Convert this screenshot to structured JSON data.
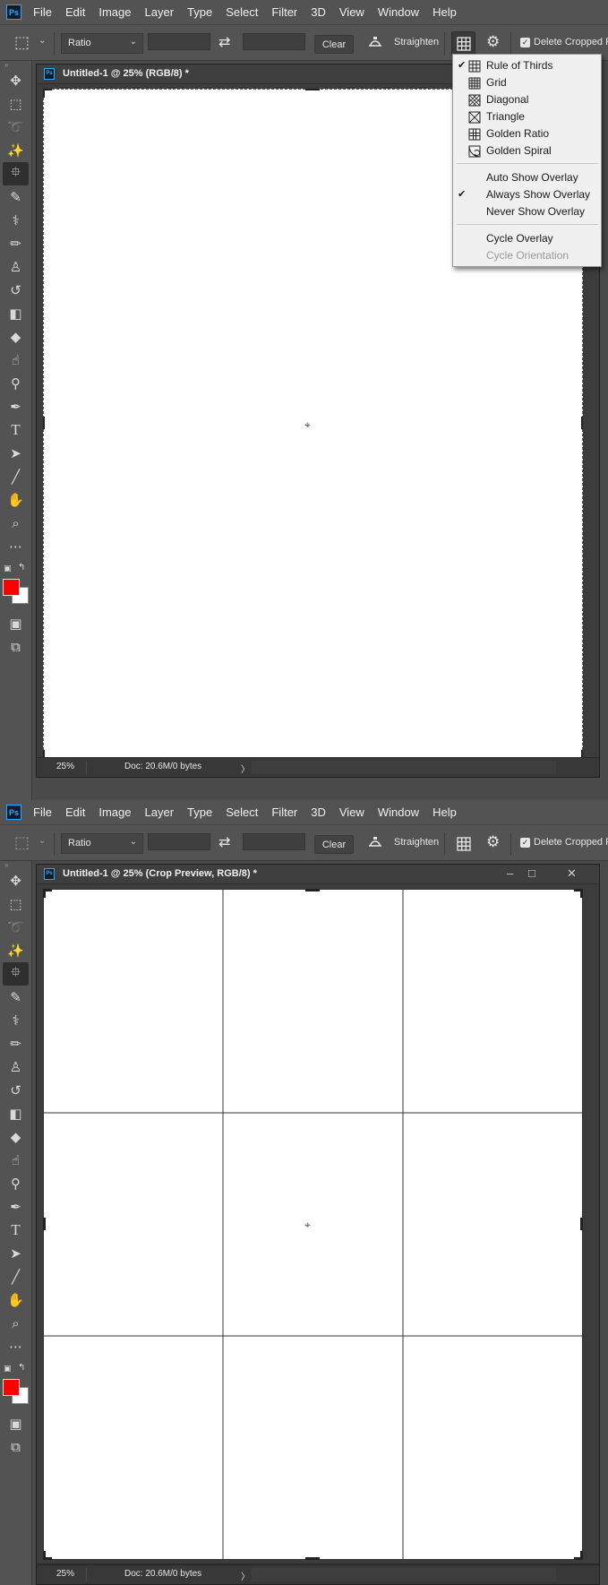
{
  "app": {
    "logo": "Ps",
    "menu": [
      "File",
      "Edit",
      "Image",
      "Layer",
      "Type",
      "Select",
      "Filter",
      "3D",
      "View",
      "Window",
      "Help"
    ]
  },
  "options_bar": {
    "ratio_label": "Ratio",
    "width_value": "",
    "height_value": "",
    "clear_label": "Clear",
    "straighten_label": "Straighten",
    "delete_cropped_label": "Delete Cropped Pi",
    "delete_cropped_checked": true
  },
  "toolbar": {
    "tools": [
      "move-icon",
      "marquee-icon",
      "lasso-icon",
      "magic-wand-icon",
      "crop-icon",
      "eyedropper-icon",
      "healing-brush-icon",
      "brush-icon",
      "clone-stamp-icon",
      "history-brush-icon",
      "eraser-icon",
      "paint-bucket-icon",
      "smudge-icon",
      "dodge-icon",
      "pen-icon",
      "type-icon",
      "path-selection-icon",
      "line-icon",
      "hand-icon",
      "zoom-icon",
      "more-tools-icon"
    ],
    "foreground_color": "#ff0000",
    "background_color": "#ffffff"
  },
  "screen1": {
    "doc_title": "Untitled-1 @ 25% (RGB/8) *",
    "zoom": "25%",
    "doc_info": "Doc: 20.6M/0 bytes",
    "overlay_menu": {
      "group1": [
        {
          "label": "Rule of Thirds",
          "checked": true,
          "icon": "rule-of-thirds-icon"
        },
        {
          "label": "Grid",
          "checked": false,
          "icon": "grid-icon"
        },
        {
          "label": "Diagonal",
          "checked": false,
          "icon": "diagonal-icon"
        },
        {
          "label": "Triangle",
          "checked": false,
          "icon": "triangle-icon"
        },
        {
          "label": "Golden Ratio",
          "checked": false,
          "icon": "golden-ratio-icon"
        },
        {
          "label": "Golden Spiral",
          "checked": false,
          "icon": "golden-spiral-icon"
        }
      ],
      "group2": [
        {
          "label": "Auto Show Overlay",
          "checked": false
        },
        {
          "label": "Always Show Overlay",
          "checked": true
        },
        {
          "label": "Never Show Overlay",
          "checked": false
        }
      ],
      "group3": [
        {
          "label": "Cycle Overlay",
          "enabled": true
        },
        {
          "label": "Cycle Orientation",
          "enabled": false
        }
      ]
    }
  },
  "screen2": {
    "doc_title": "Untitled-1 @ 25% (Crop Preview, RGB/8) *",
    "zoom": "25%",
    "doc_info": "Doc: 20.6M/0 bytes",
    "overlay": "Rule of Thirds"
  }
}
